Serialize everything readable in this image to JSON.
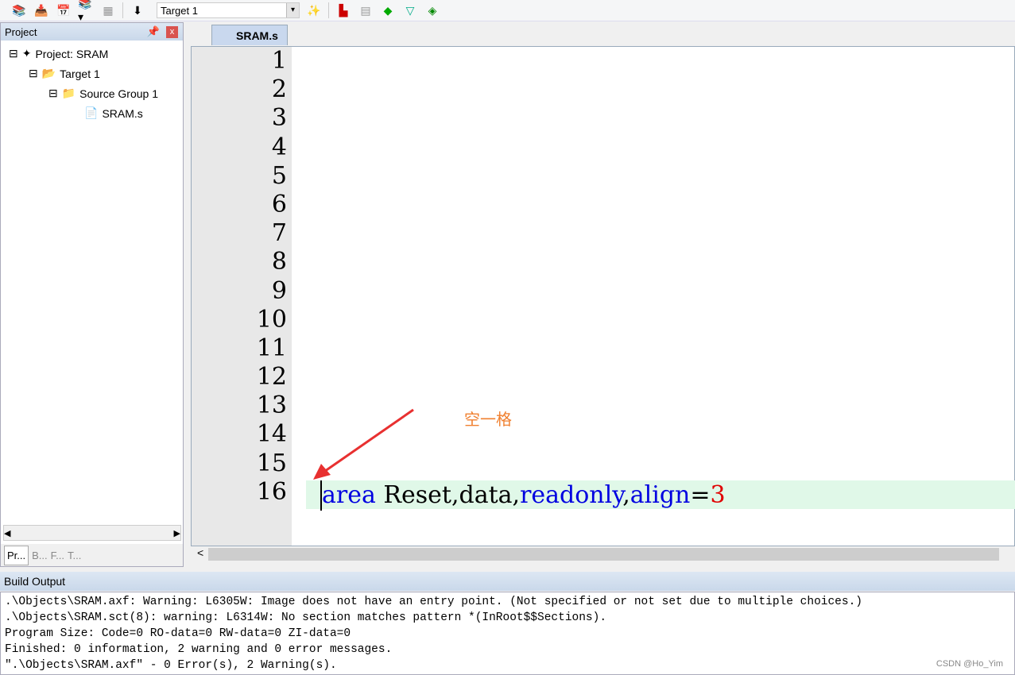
{
  "toolbar": {
    "target": "Target 1"
  },
  "project": {
    "title": "Project",
    "close": "x",
    "pin": "†",
    "tree": [
      "Project: SRAM",
      "Target 1",
      "Source Group 1",
      "SRAM.s"
    ],
    "tabs": [
      "Pr...",
      "B...",
      "F...",
      "T..."
    ]
  },
  "editor": {
    "tab": "SRAM.s",
    "line_numbers": [
      "1",
      "2",
      "3",
      "4",
      "5",
      "6",
      "7",
      "8",
      "9",
      "10",
      "11",
      "12",
      "13",
      "14",
      "15",
      "16"
    ],
    "code": {
      "kw1": "area",
      "t1": " Reset,data,",
      "kw2": "readonly",
      "t2": ",",
      "kw3": "align",
      "t3": "=",
      "num": "3"
    }
  },
  "annotation": "空一格",
  "build": {
    "title": "Build Output",
    "lines": [
      ".\\Objects\\SRAM.axf: Warning: L6305W: Image does not have an entry point. (Not specified or not set due to multiple choices.)",
      ".\\Objects\\SRAM.sct(8): warning: L6314W: No section matches pattern *(InRoot$$Sections).",
      "Program Size: Code=0 RO-data=0 RW-data=0 ZI-data=0",
      "Finished: 0 information, 2 warning and 0 error messages.",
      "\".\\Objects\\SRAM.axf\" - 0 Error(s), 2 Warning(s)."
    ]
  },
  "watermark": "CSDN @Ho_Yim"
}
